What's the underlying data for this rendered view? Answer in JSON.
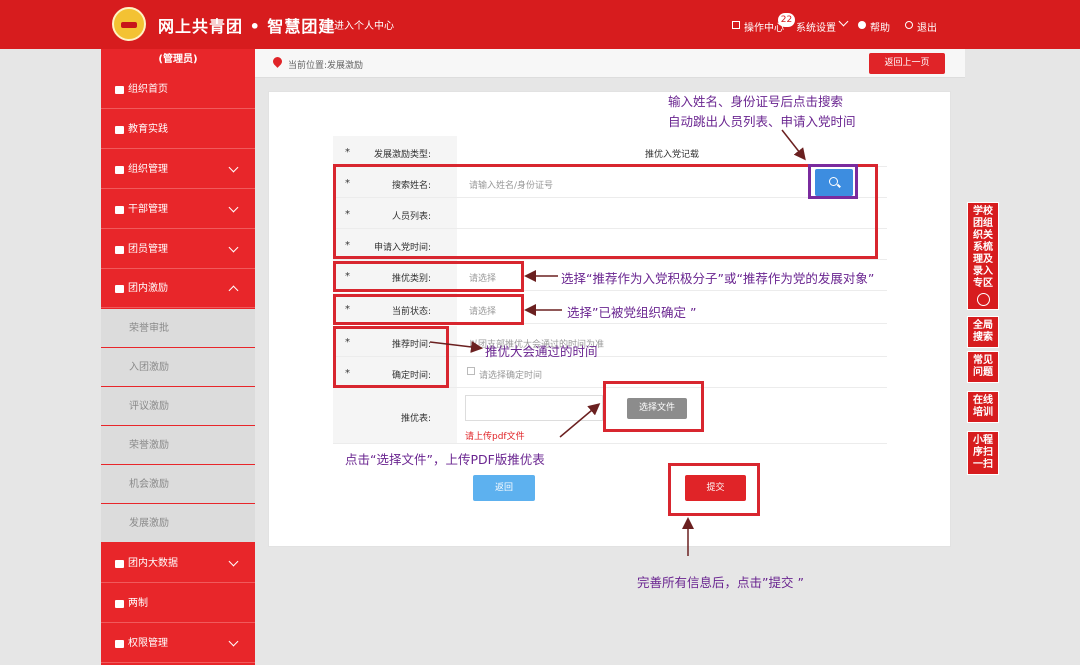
{
  "header": {
    "title": "网上共青团 • 智慧团建",
    "personal_center": "进入个人中心",
    "nav": {
      "ops": "操作中心",
      "ops_badge": "22",
      "settings": "系统设置",
      "help": "帮助",
      "logout": "退出"
    }
  },
  "sidebar": {
    "role": "(管理员)",
    "items": [
      "组织首页",
      "教育实践",
      "组织管理",
      "干部管理",
      "团员管理",
      "团内激励"
    ],
    "sub_items": [
      "荣誉审批",
      "入团激励",
      "评议激励",
      "荣誉激励",
      "机会激励",
      "发展激励"
    ],
    "bottom_items": [
      "团内大数据",
      "两制",
      "权限管理"
    ]
  },
  "breadcrumb": {
    "text": "当前位置:发展激励",
    "back_button": "返回上一页"
  },
  "form": {
    "rows": [
      {
        "star": "*",
        "label": "发展激励类型:",
        "value": "推优入党记载"
      },
      {
        "star": "*",
        "label": "搜索姓名:",
        "placeholder": "请输入姓名/身份证号"
      },
      {
        "star": "*",
        "label": "人员列表:"
      },
      {
        "star": "*",
        "label": "申请入党时间:"
      },
      {
        "star": "*",
        "label": "推优类别:",
        "placeholder": "请选择"
      },
      {
        "star": "*",
        "label": "当前状态:",
        "placeholder": "请选择"
      },
      {
        "star": "*",
        "label": "推荐时间:",
        "placeholder": "以团支部推优大会通过的时间为准"
      },
      {
        "star": "*",
        "label": "确定时间:",
        "placeholder": "请选择确定时间"
      },
      {
        "label": "推优表:"
      }
    ],
    "file_button": "选择文件",
    "pdf_hint": "请上传pdf文件",
    "back": "返回",
    "submit": "提交"
  },
  "annotations": {
    "search_line1": "输入姓名、身份证号后点击搜索",
    "search_line2": "自动跳出人员列表、申请入党时间",
    "category": "选择“推荐作为入党积极分子”或“推荐作为党的发展对象”",
    "status": "选择”已被党组织确定 ”",
    "time": "推优大会通过的时间",
    "upload": "点击“选择文件”，上传PDF版推优表",
    "submit": "完善所有信息后，点击”提交 ”"
  },
  "tools": [
    "学校团组织关系梳理及录入专区",
    "全局搜索",
    "常见问题",
    "在线培训",
    "小程序扫一扫"
  ],
  "colors": {
    "brand_red": "#d71c1e",
    "annotation_purple": "#6a2590",
    "search_blue": "#3d8de0"
  }
}
